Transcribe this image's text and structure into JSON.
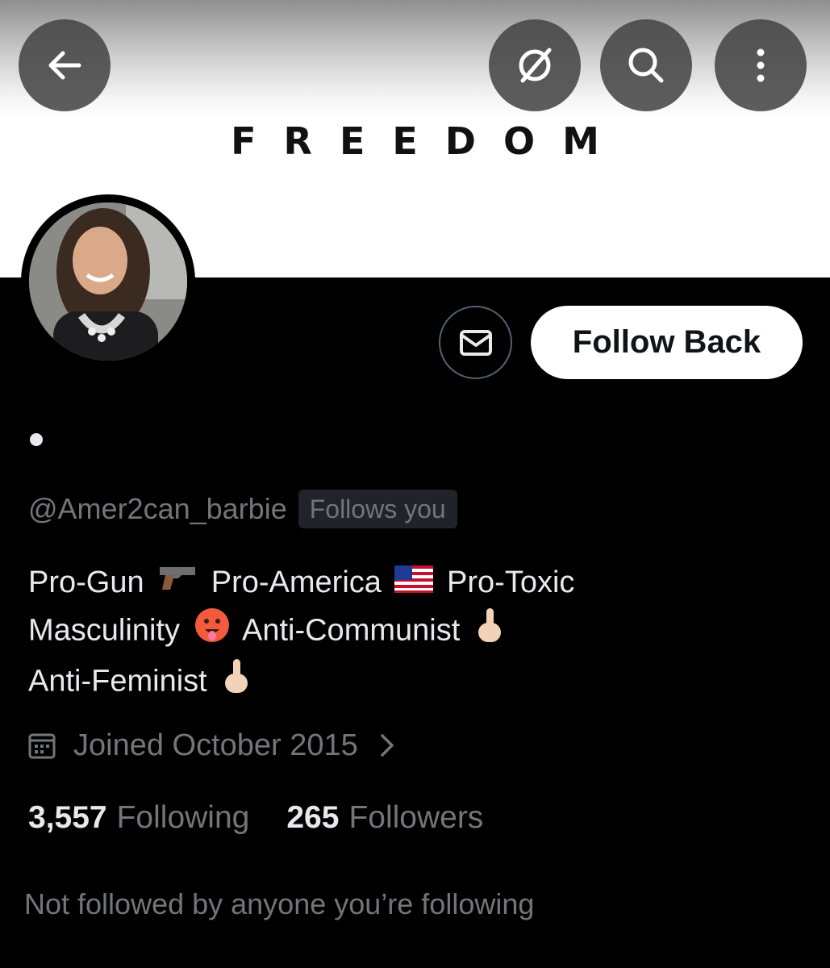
{
  "banner": {
    "text": "FREEDOM"
  },
  "header_icons": [
    "back-arrow-icon",
    "grok-icon",
    "search-icon",
    "more-options-icon"
  ],
  "profile": {
    "handle": "@Amer2can_barbie",
    "follows_you": "Follows you",
    "bio_line1_a": "Pro-Gun",
    "bio_line1_b": "Pro-America",
    "bio_line1_c": "Pro-Toxic",
    "bio_line2_a": "Masculinity",
    "bio_line2_b": "Anti-Communist",
    "bio_line3_a": "Anti-Feminist",
    "joined": "Joined October 2015",
    "following_count": "3,557",
    "following_label": "Following",
    "followers_count": "265",
    "followers_label": "Followers",
    "not_followed": "Not followed by anyone you’re following"
  },
  "actions": {
    "follow_back": "Follow Back"
  },
  "colors": {
    "background": "#000000",
    "muted": "#71767b",
    "text": "#e7e9ea",
    "button_bg": "#ffffff"
  }
}
